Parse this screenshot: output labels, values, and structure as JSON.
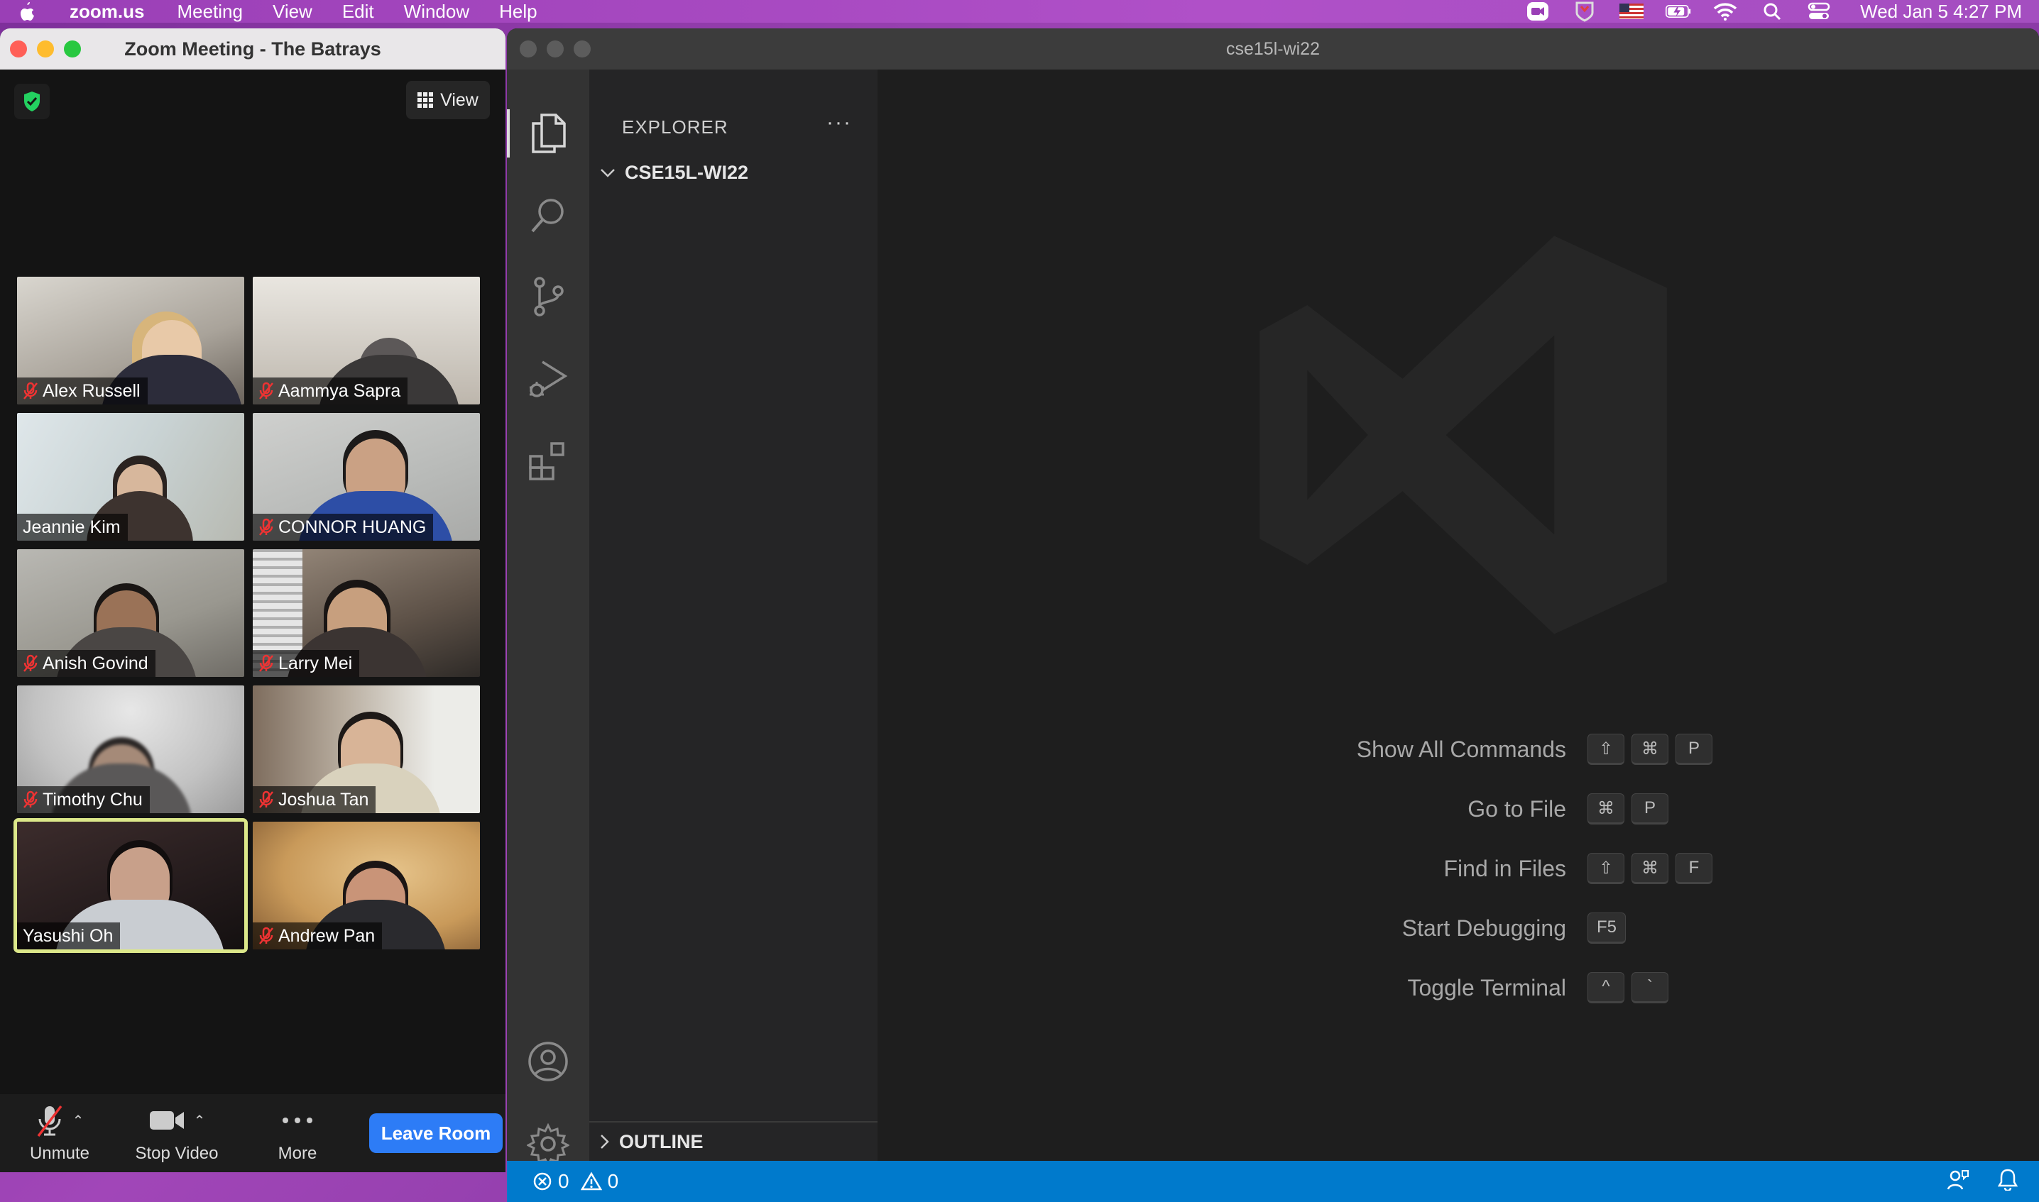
{
  "menubar": {
    "app_name": "zoom.us",
    "items": [
      "Meeting",
      "View",
      "Edit",
      "Window",
      "Help"
    ],
    "datetime": "Wed Jan 5  4:27 PM"
  },
  "zoom": {
    "title": "Zoom Meeting - The Batrays",
    "view_label": "View",
    "participants": [
      {
        "name": "Alex Russell",
        "muted": true
      },
      {
        "name": "Aammya Sapra",
        "muted": true
      },
      {
        "name": "Jeannie Kim",
        "muted": false
      },
      {
        "name": "CONNOR HUANG",
        "muted": true
      },
      {
        "name": "Anish Govind",
        "muted": true
      },
      {
        "name": "Larry Mei",
        "muted": true
      },
      {
        "name": "Timothy Chu",
        "muted": true
      },
      {
        "name": "Joshua Tan",
        "muted": true
      },
      {
        "name": "Yasushi Oh",
        "muted": false
      },
      {
        "name": "Andrew Pan",
        "muted": true
      }
    ],
    "toolbar": {
      "unmute": "Unmute",
      "stop_video": "Stop Video",
      "more": "More",
      "leave": "Leave Room"
    }
  },
  "vscode": {
    "title": "cse15l-wi22",
    "explorer_label": "EXPLORER",
    "folder": "CSE15L-WI22",
    "outline": "OUTLINE",
    "shortcuts": [
      {
        "label": "Show All Commands",
        "keys": [
          "⇧",
          "⌘",
          "P"
        ]
      },
      {
        "label": "Go to File",
        "keys": [
          "⌘",
          "P"
        ]
      },
      {
        "label": "Find in Files",
        "keys": [
          "⇧",
          "⌘",
          "F"
        ]
      },
      {
        "label": "Start Debugging",
        "keys": [
          "F5"
        ]
      },
      {
        "label": "Toggle Terminal",
        "keys": [
          "^",
          "`"
        ]
      }
    ],
    "status": {
      "errors": "0",
      "warnings": "0"
    }
  }
}
